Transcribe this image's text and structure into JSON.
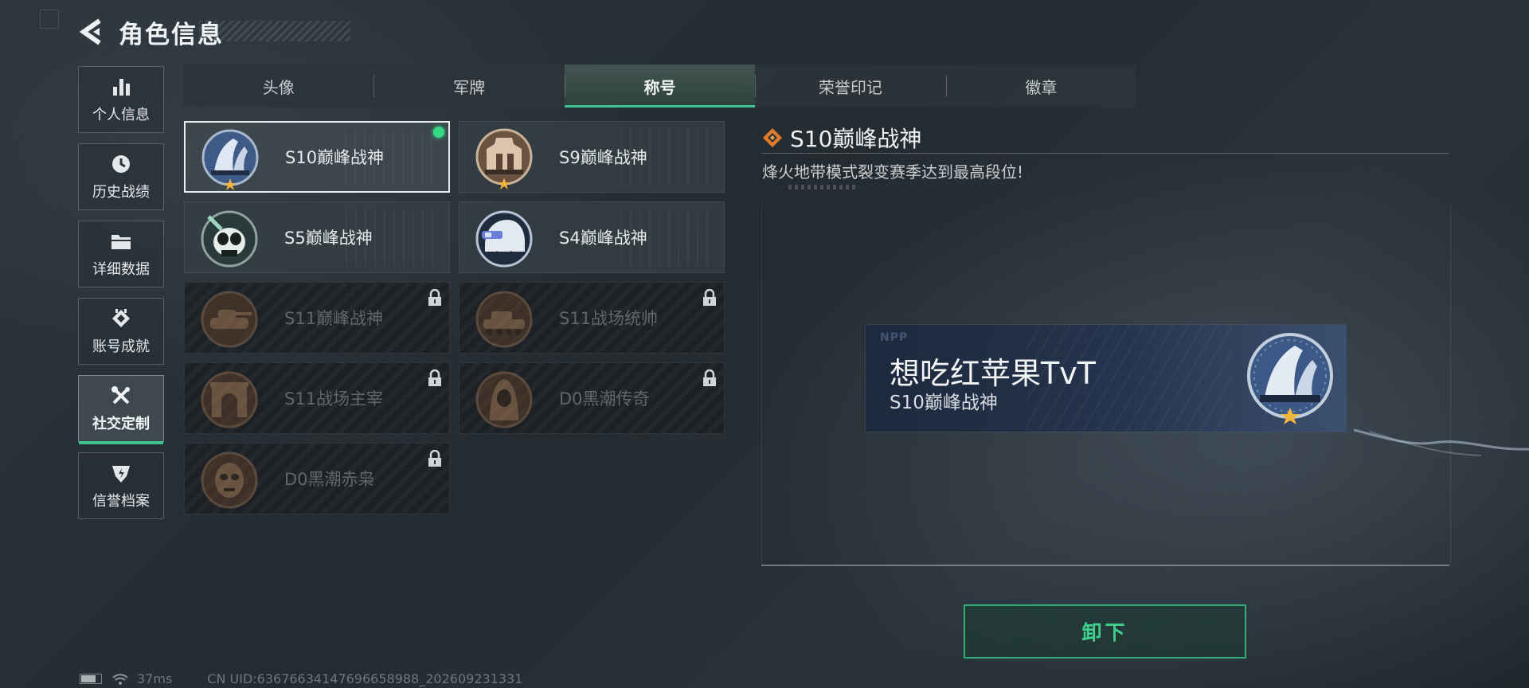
{
  "header": {
    "title": "角色信息"
  },
  "sidebar": {
    "items": [
      {
        "label": "个人信息",
        "icon": "bar-chart-icon"
      },
      {
        "label": "历史战绩",
        "icon": "clock-icon"
      },
      {
        "label": "详细数据",
        "icon": "folder-icon"
      },
      {
        "label": "账号成就",
        "icon": "achievement-icon"
      },
      {
        "label": "社交定制",
        "icon": "tools-icon",
        "active": true
      },
      {
        "label": "信誉档案",
        "icon": "shield-icon"
      }
    ]
  },
  "tabs": [
    {
      "label": "头像"
    },
    {
      "label": "军牌"
    },
    {
      "label": "称号",
      "active": true
    },
    {
      "label": "荣誉印记"
    },
    {
      "label": "徽章"
    }
  ],
  "titles": [
    {
      "name": "S10巅峰战神",
      "medal": "tower-medal-icon",
      "selected": true,
      "equipped": true,
      "locked": false
    },
    {
      "name": "S9巅峰战神",
      "medal": "fortress-medal-icon",
      "selected": false,
      "equipped": false,
      "locked": false
    },
    {
      "name": "S5巅峰战神",
      "medal": "skull-medal-icon",
      "selected": false,
      "equipped": false,
      "locked": false
    },
    {
      "name": "S4巅峰战神",
      "medal": "helmet-medal-icon",
      "selected": false,
      "equipped": false,
      "locked": false
    },
    {
      "name": "S11巅峰战神",
      "medal": "tank-medal-icon",
      "selected": false,
      "equipped": false,
      "locked": true
    },
    {
      "name": "S11战场统帅",
      "medal": "vehicle-medal-icon",
      "selected": false,
      "equipped": false,
      "locked": true
    },
    {
      "name": "S11战场主宰",
      "medal": "arch-medal-icon",
      "selected": false,
      "equipped": false,
      "locked": true
    },
    {
      "name": "D0黑潮传奇",
      "medal": "hooded-medal-icon",
      "selected": false,
      "equipped": false,
      "locked": true
    },
    {
      "name": "D0黑潮赤枭",
      "medal": "mask-medal-icon",
      "selected": false,
      "equipped": false,
      "locked": true
    }
  ],
  "detail": {
    "title": "S10巅峰战神",
    "description": "烽火地带模式裂变赛季达到最高段位!"
  },
  "name_card": {
    "logo": "NPP",
    "player_name": "想吃红苹果TvT",
    "title": "S10巅峰战神"
  },
  "actions": {
    "unequip_label": "卸下"
  },
  "footer": {
    "ping": "37ms",
    "uid": "CN UID:6367663414769665898​8_202609231331"
  },
  "colors": {
    "accent": "#3ec48c",
    "equipped_dot": "#35d884",
    "button_text": "#40d18d"
  }
}
